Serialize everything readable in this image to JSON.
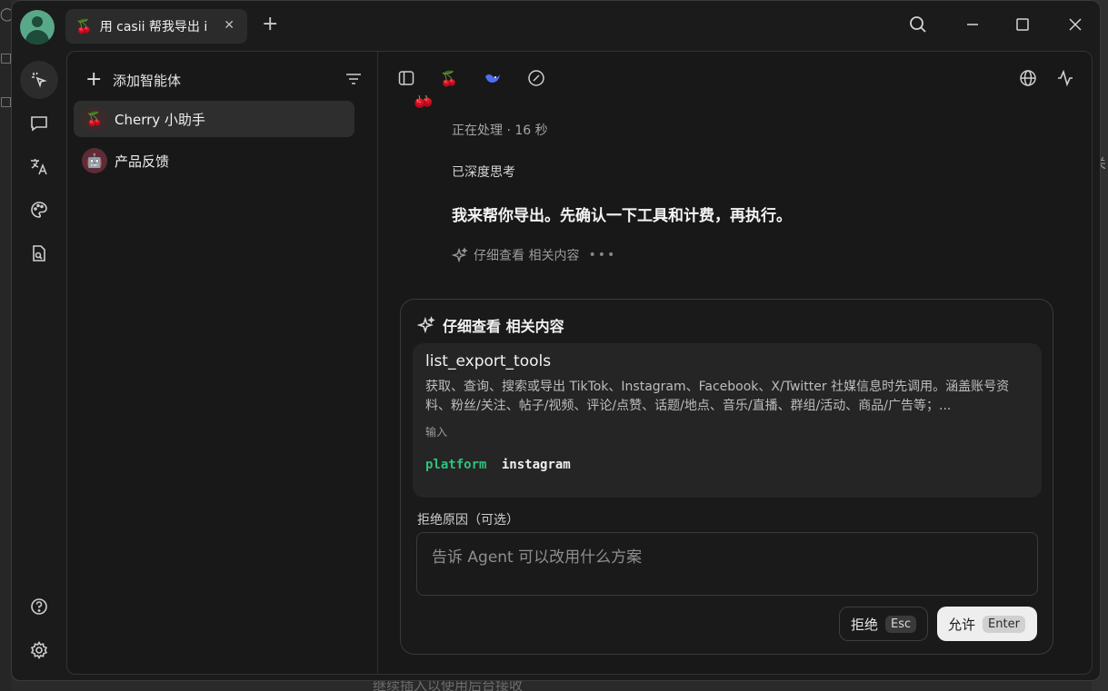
{
  "window": {
    "tab_title": "用 casii 帮我导出 i",
    "tab_emoji": "🍒"
  },
  "agents": {
    "add_label": "添加智能体",
    "items": [
      {
        "name": "Cherry 小助手",
        "emoji": "🍒",
        "selected": true
      },
      {
        "name": "产品反馈",
        "emoji": "🤖",
        "selected": false
      }
    ]
  },
  "chat": {
    "status": "正在处理 · 16 秒",
    "thought": "已深度思考",
    "answer": "我来帮你导出。先确认一下工具和计费，再执行。",
    "related_link": "仔细查看 相关内容",
    "related_dots": "•••"
  },
  "approval": {
    "title": "仔细查看 相关内容",
    "tool_name": "list_export_tools",
    "tool_description": "获取、查询、搜索或导出 TikTok、Instagram、Facebook、X/Twitter 社媒信息时先调用。涵盖账号资料、粉丝/关注、帖子/视频、评论/点赞、话题/地点、音乐/直播、群组/活动、商品/广告等；...",
    "input_label": "输入",
    "param_key": "platform",
    "param_value": "instagram",
    "reason_label": "拒绝原因（可选）",
    "reason_placeholder": "告诉 Agent 可以改用什么方案",
    "reject_label": "拒绝",
    "reject_key": "Esc",
    "allow_label": "允许",
    "allow_key": "Enter"
  },
  "background": {
    "bottom_text": "继续插入以使用后台接收"
  },
  "colors": {
    "accent_green": "#2ec27e",
    "window_bg": "#1b1b1b",
    "panel_bg": "#181818"
  }
}
